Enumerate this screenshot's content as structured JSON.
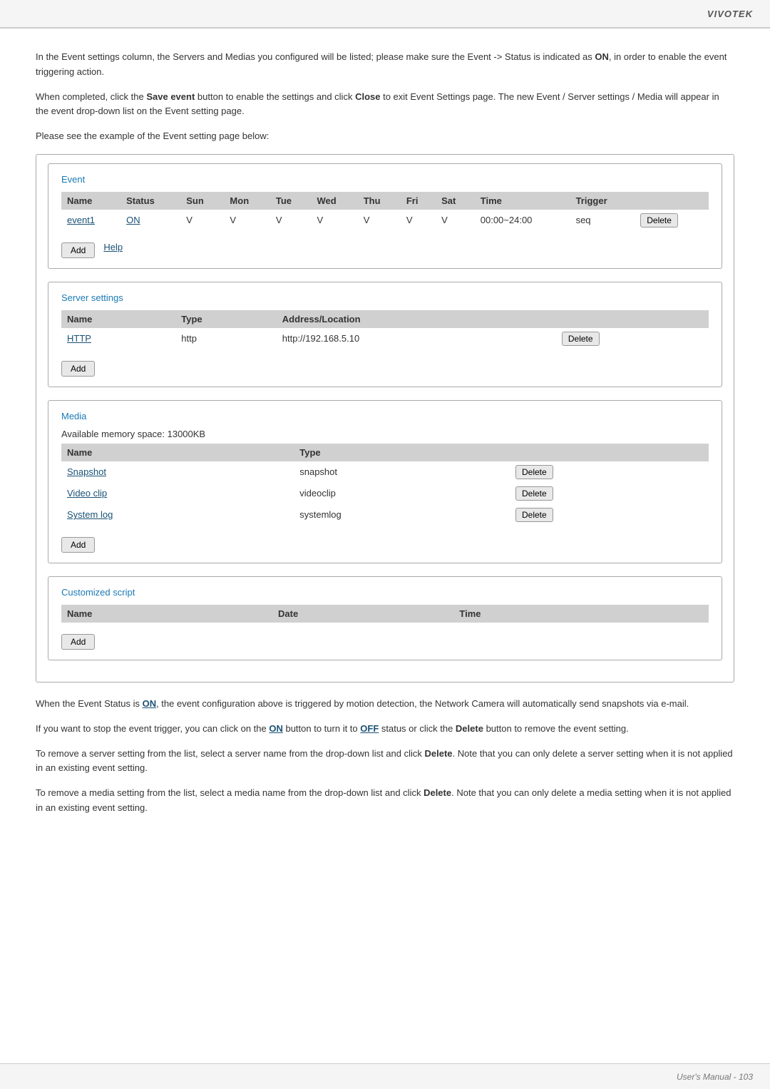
{
  "header": {
    "brand": "VIVOTEK"
  },
  "footer": {
    "text": "User's Manual - 103"
  },
  "paragraphs": {
    "p1_part1": "In the Event settings column, the Servers and Medias you configured will be listed; please make sure the Event -> Status is indicated as ",
    "p1_on": "ON",
    "p1_part2": ", in order to enable the event triggering action.",
    "p2_part1": "When completed, click the ",
    "p2_save": "Save event",
    "p2_part2": " button to enable the settings and click ",
    "p2_close": "Close",
    "p2_part3": " to exit Event Settings page. The new Event / Server settings / Media will appear in the event drop-down list on the Event setting page.",
    "p3": "Please see the example of the Event setting page below:",
    "p_after1_part1": "When the Event Status is ",
    "p_after1_on": "ON",
    "p_after1_part2": ", the event configuration above is triggered by motion detection, the Network Camera will  automatically send snapshots via e-mail.",
    "p_after2_part1": "If you want to stop the event trigger, you can click on the ",
    "p_after2_on": "ON",
    "p_after2_part2": " button to turn it to ",
    "p_after2_off": "OFF",
    "p_after2_part3": " status or click the ",
    "p_after2_delete": "Delete",
    "p_after2_part4": " button to remove the event setting.",
    "p_after3_part1": "To remove a server setting from the list, select a server name from the drop-down list and click ",
    "p_after3_delete": "Delete",
    "p_after3_part2": ". Note that you can only delete a server setting when it is not applied in an existing event setting.",
    "p_after4_part1": "To remove a media setting from the list, select a media name from the drop-down list and click ",
    "p_after4_delete": "Delete",
    "p_after4_part2": ". Note that you can only delete a media setting when it is not applied in an existing event setting."
  },
  "event_section": {
    "title": "Event",
    "table_headers": [
      "Name",
      "Status",
      "Sun",
      "Mon",
      "Tue",
      "Wed",
      "Thu",
      "Fri",
      "Sat",
      "Time",
      "Trigger",
      ""
    ],
    "table_row": {
      "name": "event1",
      "status": "ON",
      "sun": "V",
      "mon": "V",
      "tue": "V",
      "wed": "V",
      "thu": "V",
      "fri": "V",
      "sat": "V",
      "time": "00:00~24:00",
      "trigger": "seq",
      "delete_label": "Delete"
    },
    "add_label": "Add",
    "help_label": "Help"
  },
  "server_section": {
    "title": "Server settings",
    "table_headers": [
      "Name",
      "Type",
      "Address/Location",
      ""
    ],
    "table_row": {
      "name": "HTTP",
      "type": "http",
      "address": "http://192.168.5.10",
      "delete_label": "Delete"
    },
    "add_label": "Add"
  },
  "media_section": {
    "title": "Media",
    "memory_note": "Available memory space: 13000KB",
    "table_headers": [
      "Name",
      "Type",
      ""
    ],
    "table_rows": [
      {
        "name": "Snapshot",
        "type": "snapshot",
        "delete_label": "Delete"
      },
      {
        "name": "Video clip",
        "type": "videoclip",
        "delete_label": "Delete"
      },
      {
        "name": "System log",
        "type": "systemlog",
        "delete_label": "Delete"
      }
    ],
    "add_label": "Add"
  },
  "customized_section": {
    "title": "Customized script",
    "table_headers": [
      "Name",
      "Date",
      "Time",
      ""
    ],
    "add_label": "Add"
  }
}
